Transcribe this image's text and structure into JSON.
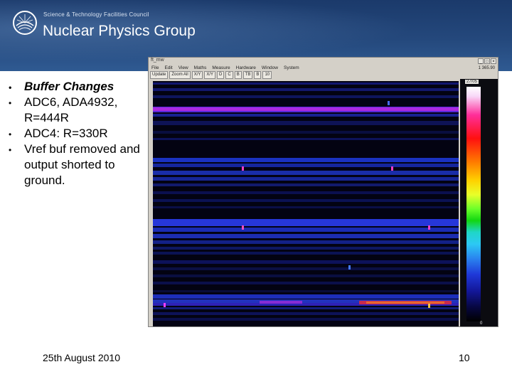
{
  "header": {
    "council": "Science & Technology Facilities Council",
    "group": "Nuclear Physics Group"
  },
  "bullets": [
    "Buffer Changes",
    "ADC6, ADA4932, R=444R",
    "ADC4: R=330R",
    "Vref buf removed and output shorted to ground."
  ],
  "footer": {
    "date": "25th August 2010",
    "page": "10"
  },
  "window": {
    "title": "ft_mw",
    "menus": [
      "File",
      "Edit",
      "View",
      "Maths",
      "Measure",
      "Hardware",
      "Window",
      "System"
    ],
    "toolbar": [
      "Update",
      "Zoom All",
      "X/Y",
      "X/Y",
      "D",
      "C",
      "B",
      "TB",
      "B",
      "10"
    ],
    "toolbar_right": "1 365.90",
    "scale_top": "27/05",
    "scale_bottom": "0"
  },
  "colors": {
    "banner": "#24487c",
    "heatmap_bg": "#030312",
    "stripe_blue": "#1f3be0",
    "stripe_magenta": "#d92ae6",
    "stripe_red": "#ff2a2a"
  }
}
